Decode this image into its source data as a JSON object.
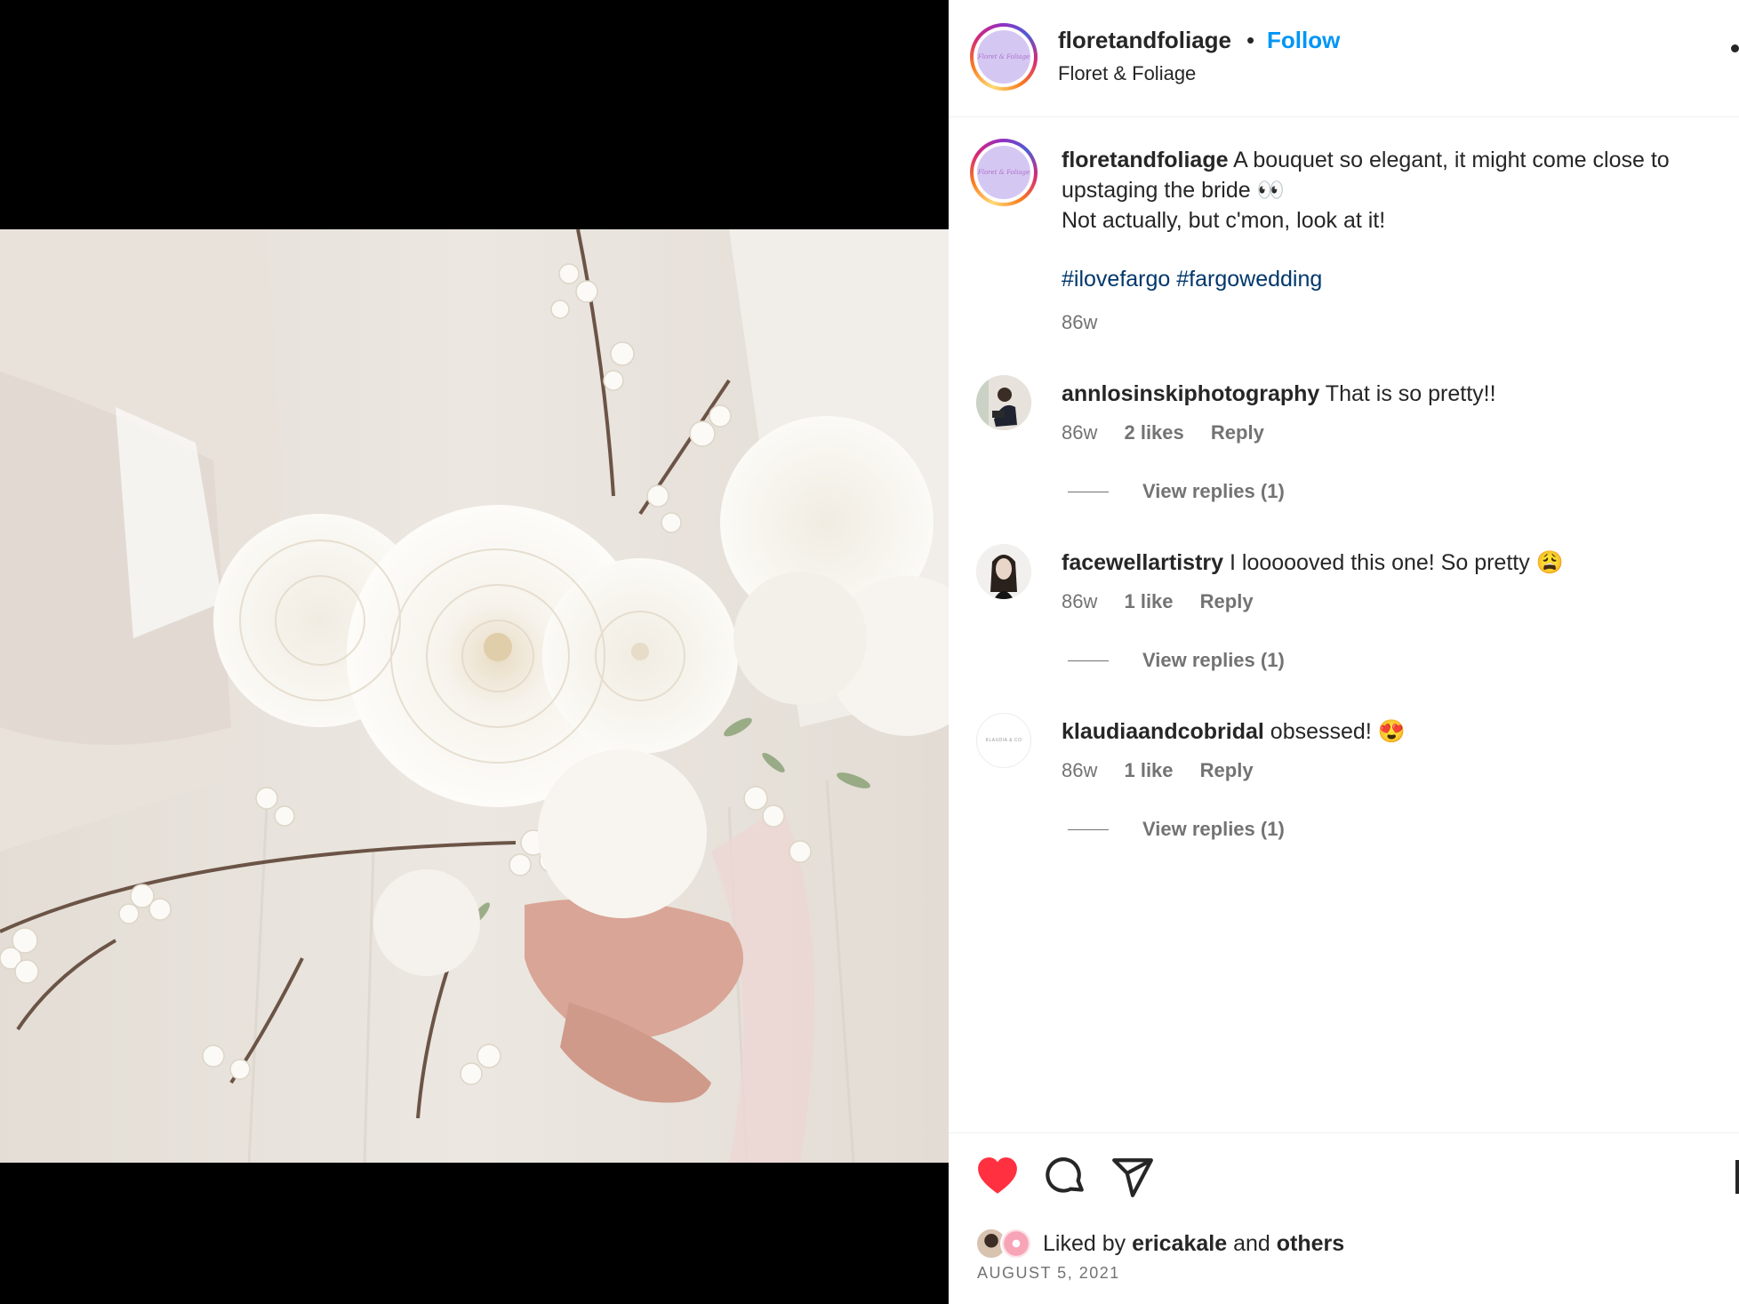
{
  "post": {
    "username": "floretandfoliage",
    "follow_label": "Follow",
    "display_name": "Floret & Foliage",
    "avatar_text": "Floret & Foliage"
  },
  "caption": {
    "username": "floretandfoliage",
    "line1": "A bouquet so elegant, it might come close to upstaging the bride 👀",
    "line2": "Not actually, but c'mon, look at it!",
    "tag1": "#ilovefargo",
    "tag2": "#fargowedding",
    "time": "86w"
  },
  "comments": [
    {
      "username": "annlosinskiphotography",
      "text": "That is so pretty!!",
      "time": "86w",
      "likes": "2 likes",
      "reply": "Reply",
      "replies": "View replies (1)"
    },
    {
      "username": "facewellartistry",
      "text": "I loooooved this one! So pretty 😩",
      "time": "86w",
      "likes": "1 like",
      "reply": "Reply",
      "replies": "View replies (1)"
    },
    {
      "username": "klaudiaandcobridal",
      "text": "obsessed! 😍",
      "time": "86w",
      "likes": "1 like",
      "reply": "Reply",
      "replies": "View replies (1)",
      "avatar_text": "KLAUDIA & CO"
    }
  ],
  "likes": {
    "prefix": "Liked by",
    "user": "ericakale",
    "and": "and",
    "others": "others"
  },
  "date": "AUGUST 5, 2021",
  "icons": {
    "like": "heart-icon",
    "comment": "comment-icon",
    "share": "paper-plane-icon",
    "save": "bookmark-icon"
  },
  "colors": {
    "link": "#0095f6",
    "hashtag": "#00376b",
    "heart": "#ff3040",
    "muted": "#737373"
  }
}
